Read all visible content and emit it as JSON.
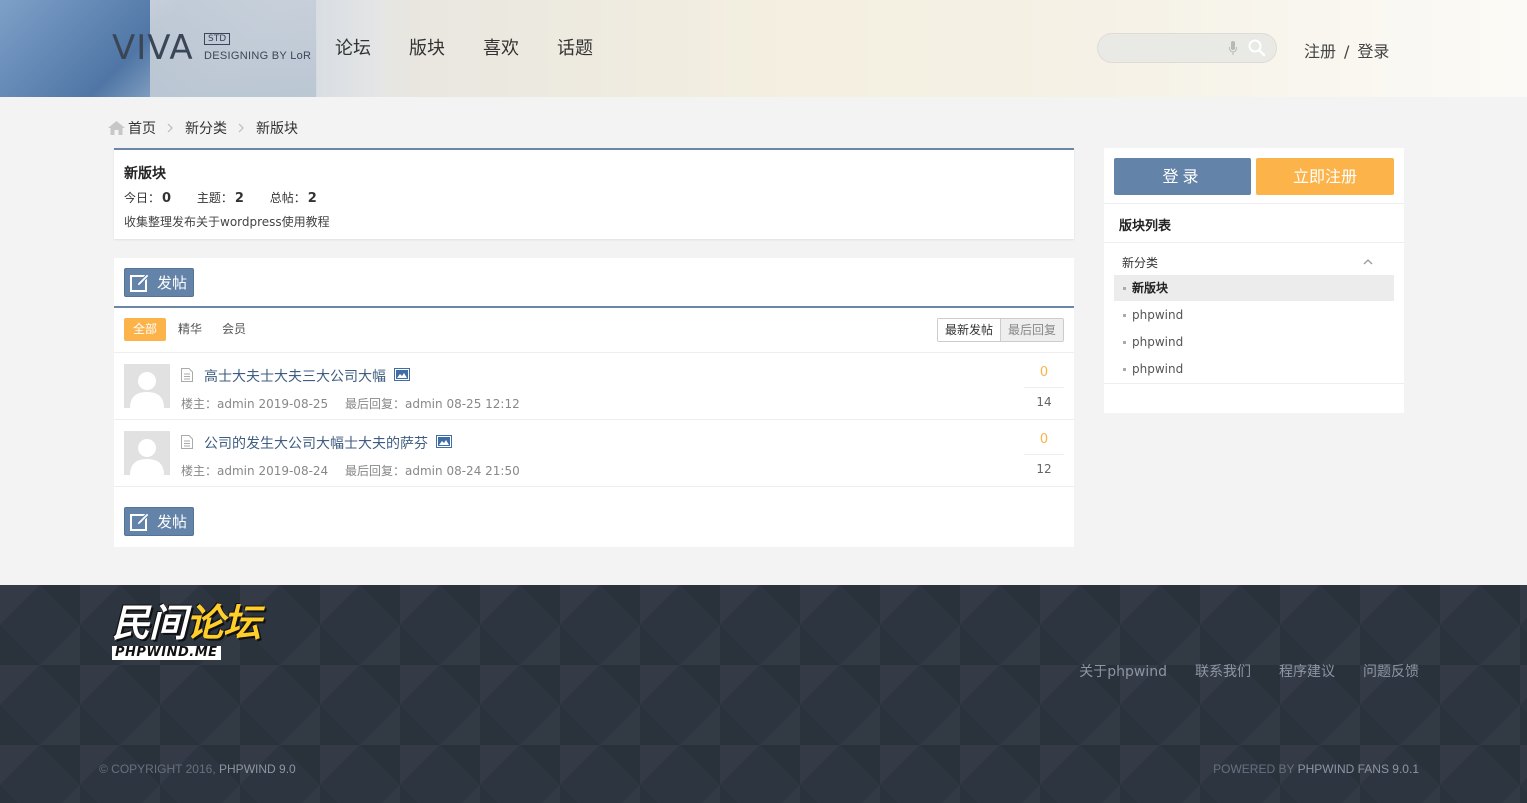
{
  "header": {
    "logo": {
      "main": "VIVA",
      "badge": "STD",
      "sub": "DESIGNING BY LoR"
    },
    "nav": [
      "论坛",
      "版块",
      "喜欢",
      "话题"
    ],
    "search": {
      "placeholder": ""
    },
    "auth": {
      "register": "注册",
      "separator": "/",
      "login": "登录"
    }
  },
  "breadcrumb": [
    "首页",
    "新分类",
    "新版块"
  ],
  "forum": {
    "title": "新版块",
    "stats": [
      {
        "label": "今日：",
        "value": "0"
      },
      {
        "label": "主题：",
        "value": "2"
      },
      {
        "label": "总帖：",
        "value": "2"
      }
    ],
    "description": "收集整理发布关于wordpress使用教程"
  },
  "thread_list": {
    "post_button": "发帖",
    "filters": [
      "全部",
      "精华",
      "会员"
    ],
    "sort": [
      "最新发帖",
      "最后回复"
    ],
    "threads": [
      {
        "title": "高士大夫士大夫三大公司大幅",
        "meta_author": "楼主：admin",
        "meta_date": "2019-08-25",
        "meta_last": "最后回复：admin",
        "meta_last_time": "08-25 12:12",
        "replies": "0",
        "views": "14"
      },
      {
        "title": "公司的发生大公司大幅士大夫的萨芬",
        "meta_author": "楼主：admin",
        "meta_date": "2019-08-24",
        "meta_last": "最后回复：admin",
        "meta_last_time": "08-24 21:50",
        "replies": "0",
        "views": "12"
      }
    ]
  },
  "sidebar": {
    "login_button": "登录",
    "register_button": "立即注册",
    "title": "版块列表",
    "category": "新分类",
    "items": [
      "新版块",
      "phpwind",
      "phpwind",
      "phpwind"
    ]
  },
  "footer": {
    "logo_main_a": "民间",
    "logo_main_b": "论坛",
    "logo_sub": "PHPWIND.ME",
    "links": [
      "关于phpwind",
      "联系我们",
      "程序建议",
      "问题反馈"
    ],
    "copyright_prefix": "© COPYRIGHT 2016,",
    "copyright_brand": "PHPWIND 9.0",
    "powered_prefix": "POWERED BY",
    "powered_brand": "PHPWIND FANS 9.0.1"
  },
  "colors": {
    "accent_blue": "#6383a8",
    "accent_orange": "#fbb34a",
    "footer_bg": "#2d3540"
  }
}
